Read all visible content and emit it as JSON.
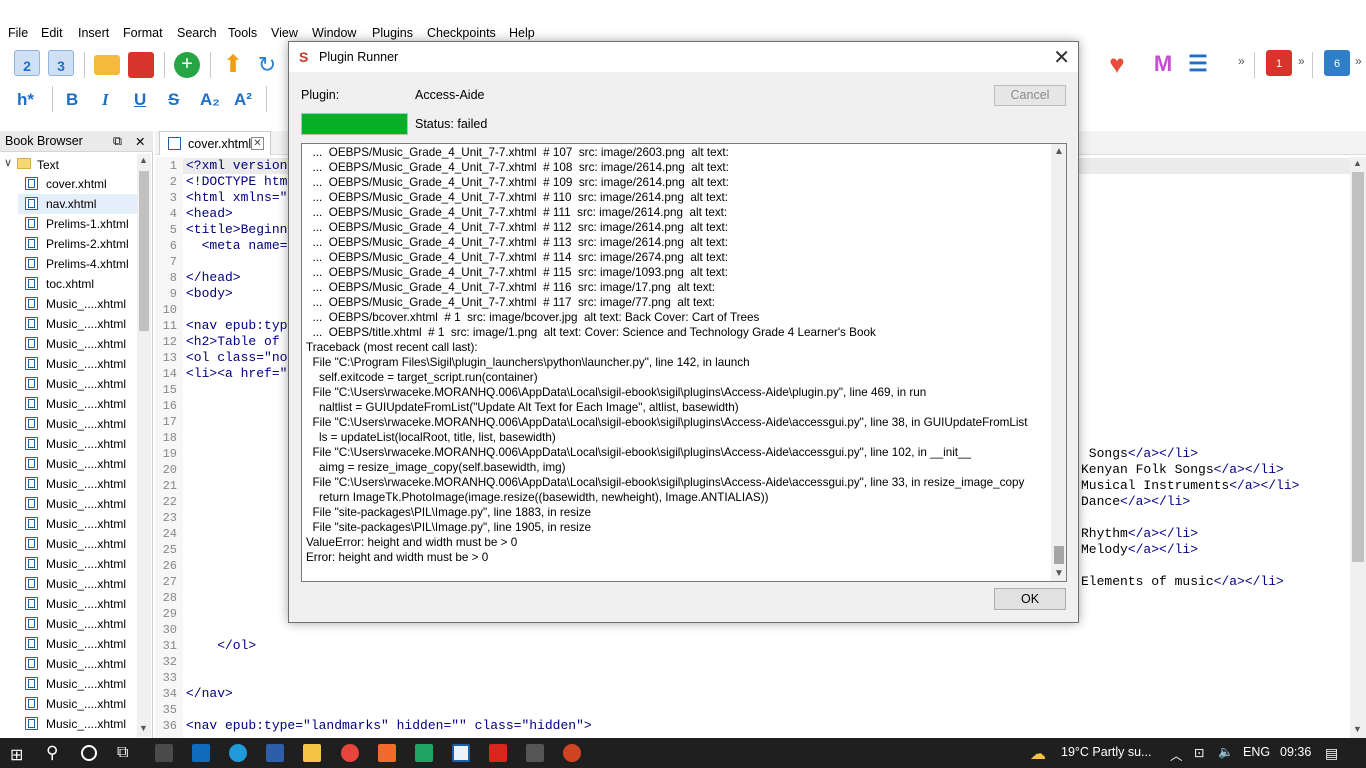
{
  "menu": [
    "File",
    "Edit",
    "Insert",
    "Format",
    "Search",
    "Tools",
    "View",
    "Window",
    "Plugins",
    "Checkpoints",
    "Help"
  ],
  "toolbar": {
    "icons": [
      "heading-2-icon",
      "heading-3-icon",
      "open-folder-icon",
      "save-icon",
      "add-file-icon",
      "upload-arrow-icon",
      "refresh-icon"
    ],
    "right_icons": [
      "heart-icon",
      "m-plugin-icon",
      "list-icon",
      "plugin-red-icon",
      "plugin-blue-icon"
    ],
    "plugin_red_badge": "1",
    "plugin_blue_badge": "6",
    "overflow": "»"
  },
  "format_bar": {
    "heading": "h*",
    "bold": "B",
    "italic": "I",
    "underline": "U",
    "strike": "S",
    "sub": "A₂",
    "sup": "A²"
  },
  "book_browser": {
    "title": "Book Browser",
    "folder": "Text",
    "files": [
      "cover.xhtml",
      "nav.xhtml",
      "Prelims-1.xhtml",
      "Prelims-2.xhtml",
      "Prelims-4.xhtml",
      "toc.xhtml",
      "Music_....xhtml",
      "Music_....xhtml",
      "Music_....xhtml",
      "Music_....xhtml",
      "Music_....xhtml",
      "Music_....xhtml",
      "Music_....xhtml",
      "Music_....xhtml",
      "Music_....xhtml",
      "Music_....xhtml",
      "Music_....xhtml",
      "Music_....xhtml",
      "Music_....xhtml",
      "Music_....xhtml",
      "Music_....xhtml",
      "Music_....xhtml",
      "Music_....xhtml",
      "Music_....xhtml",
      "Music_....xhtml",
      "Music_....xhtml",
      "Music_....xhtml",
      "Music_....xhtml"
    ],
    "selected_index": 1
  },
  "editor": {
    "tab_label": "cover.xhtml",
    "line_numbers": [
      "1",
      "2",
      "3",
      "4",
      "5",
      "6",
      "7",
      "8",
      "9",
      "10",
      "11",
      "12",
      "13",
      "14",
      "15",
      "16",
      "17",
      "18",
      "19",
      "20",
      "21",
      "22",
      "23",
      "24",
      "25",
      "26",
      "27",
      "28",
      "29",
      "30",
      "31",
      "32",
      "33",
      "34",
      "35",
      "36"
    ],
    "left_lines": [
      {
        "n": 1,
        "text": "<?xml version"
      },
      {
        "n": 2,
        "text": "<!DOCTYPE htm"
      },
      {
        "n": 3,
        "text": "<html xmlns=\""
      },
      {
        "n": 4,
        "text": "<head>"
      },
      {
        "n": 5,
        "text": "<title>Beginn"
      },
      {
        "n": 6,
        "text": "  <meta name="
      },
      {
        "n": 8,
        "text": "</head>"
      },
      {
        "n": 9,
        "text": "<body>"
      },
      {
        "n": 11,
        "text": "<nav epub:typ"
      },
      {
        "n": 12,
        "text": "<h2>Table of "
      },
      {
        "n": 13,
        "text": "<ol class=\"no"
      },
      {
        "n": 14,
        "text": "<li><a href=\""
      },
      {
        "n": 31,
        "text": "    </ol>"
      },
      {
        "n": 34,
        "text": "</nav>"
      },
      {
        "n": 36,
        "text": "<nav epub:type=\"landmarks\" hidden=\"\" class=\"hidden\">"
      }
    ],
    "right_lines": [
      {
        "n": 19,
        "text": " Songs",
        "tag": "</a></li>"
      },
      {
        "n": 20,
        "text": "Kenyan Folk Songs",
        "tag": "</a></li>"
      },
      {
        "n": 21,
        "text": "Musical Instruments",
        "tag": "</a></li>"
      },
      {
        "n": 22,
        "text": "Dance",
        "tag": "</a></li>"
      },
      {
        "n": 24,
        "text": "Rhythm",
        "tag": "</a></li>"
      },
      {
        "n": 25,
        "text": "Melody",
        "tag": "</a></li>"
      },
      {
        "n": 27,
        "text": "Elements of music",
        "tag": "</a></li>"
      }
    ]
  },
  "dialog": {
    "title": "Plugin Runner",
    "plugin_label": "Plugin:",
    "plugin_name": "Access-Aide",
    "cancel_label": "Cancel",
    "progress": 1.0,
    "status": "Status: failed",
    "ok_label": "OK",
    "log": [
      "  ...  OEBPS/Music_Grade_4_Unit_7-7.xhtml  # 107  src: image/2603.png  alt text:",
      "  ...  OEBPS/Music_Grade_4_Unit_7-7.xhtml  # 108  src: image/2614.png  alt text:",
      "  ...  OEBPS/Music_Grade_4_Unit_7-7.xhtml  # 109  src: image/2614.png  alt text:",
      "  ...  OEBPS/Music_Grade_4_Unit_7-7.xhtml  # 110  src: image/2614.png  alt text:",
      "  ...  OEBPS/Music_Grade_4_Unit_7-7.xhtml  # 111  src: image/2614.png  alt text:",
      "  ...  OEBPS/Music_Grade_4_Unit_7-7.xhtml  # 112  src: image/2614.png  alt text:",
      "  ...  OEBPS/Music_Grade_4_Unit_7-7.xhtml  # 113  src: image/2614.png  alt text:",
      "  ...  OEBPS/Music_Grade_4_Unit_7-7.xhtml  # 114  src: image/2674.png  alt text:",
      "  ...  OEBPS/Music_Grade_4_Unit_7-7.xhtml  # 115  src: image/1093.png  alt text:",
      "  ...  OEBPS/Music_Grade_4_Unit_7-7.xhtml  # 116  src: image/17.png  alt text:",
      "  ...  OEBPS/Music_Grade_4_Unit_7-7.xhtml  # 117  src: image/77.png  alt text:",
      "  ...  OEBPS/bcover.xhtml  # 1  src: image/bcover.jpg  alt text: Back Cover: Cart of Trees",
      "  ...  OEBPS/title.xhtml  # 1  src: image/1.png  alt text: Cover: Science and Technology Grade 4 Learner's Book",
      "Traceback (most recent call last):",
      "  File \"C:\\Program Files\\Sigil\\plugin_launchers\\python\\launcher.py\", line 142, in launch",
      "    self.exitcode = target_script.run(container)",
      "  File \"C:\\Users\\rwaceke.MORANHQ.006\\AppData\\Local\\sigil-ebook\\sigil\\plugins\\Access-Aide\\plugin.py\", line 469, in run",
      "    naltlist = GUIUpdateFromList(\"Update Alt Text for Each Image\", altlist, basewidth)",
      "  File \"C:\\Users\\rwaceke.MORANHQ.006\\AppData\\Local\\sigil-ebook\\sigil\\plugins\\Access-Aide\\accessgui.py\", line 38, in GUIUpdateFromList",
      "    ls = updateList(localRoot, title, list, basewidth)",
      "  File \"C:\\Users\\rwaceke.MORANHQ.006\\AppData\\Local\\sigil-ebook\\sigil\\plugins\\Access-Aide\\accessgui.py\", line 102, in __init__",
      "    aimg = resize_image_copy(self.basewidth, img)",
      "  File \"C:\\Users\\rwaceke.MORANHQ.006\\AppData\\Local\\sigil-ebook\\sigil\\plugins\\Access-Aide\\accessgui.py\", line 33, in resize_image_copy",
      "    return ImageTk.PhotoImage(image.resize((basewidth, newheight), Image.ANTIALIAS))",
      "  File \"site-packages\\PIL\\Image.py\", line 1883, in resize",
      "  File \"site-packages\\PIL\\Image.py\", line 1905, in resize",
      "ValueError: height and width must be > 0",
      "Error: height and width must be > 0"
    ]
  },
  "taskbar": {
    "weather": "19°C  Partly su...",
    "language": "ENG",
    "time": "09:36"
  },
  "colors": {
    "progress": "#06b025",
    "accent": "#1f6fc5",
    "taskbar": "#1f1f1f"
  }
}
